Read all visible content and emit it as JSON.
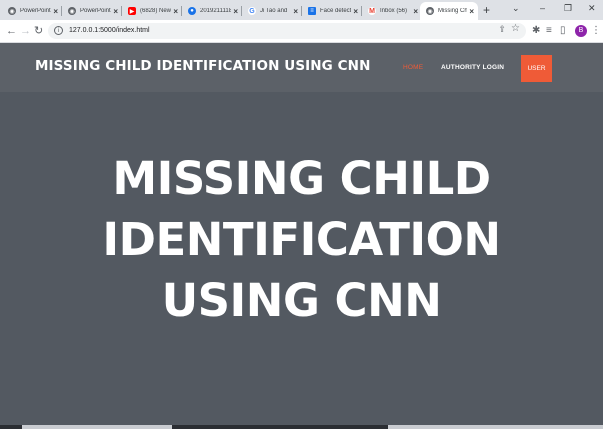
{
  "browser": {
    "tabs": [
      {
        "title": "PowerPoint",
        "favicon": "globe-icon",
        "color": "#5f6368"
      },
      {
        "title": "PowerPoint",
        "favicon": "globe-icon",
        "color": "#5f6368"
      },
      {
        "title": "(6828) New",
        "favicon": "youtube-icon",
        "color": "#ff0000"
      },
      {
        "title": "2019211118",
        "favicon": "people-icon",
        "color": "#1a73e8"
      },
      {
        "title": "Ji Tao and",
        "favicon": "google-icon",
        "color": "#4285f4"
      },
      {
        "title": "Face detect",
        "favicon": "doc-icon",
        "color": "#1a73e8"
      },
      {
        "title": "Inbox (56)",
        "favicon": "gmail-icon",
        "color": "#ea4335"
      },
      {
        "title": "Missing Ch",
        "favicon": "globe-icon",
        "color": "#5f6368",
        "active": true
      }
    ],
    "url": "127.0.0.1:5000/index.html",
    "profile_initial": "B"
  },
  "site": {
    "logo": "MISSING CHILD IDENTIFICATION USING CNN",
    "nav": {
      "home": "HOME",
      "authority_login": "AUTHORITY LOGIN",
      "user": "USER"
    },
    "hero_title": "MISSING CHILD IDENTIFICATION USING CNN"
  },
  "colors": {
    "accent": "#ef5b37",
    "header_bg": "#5c6168",
    "hero_bg": "#535961"
  }
}
